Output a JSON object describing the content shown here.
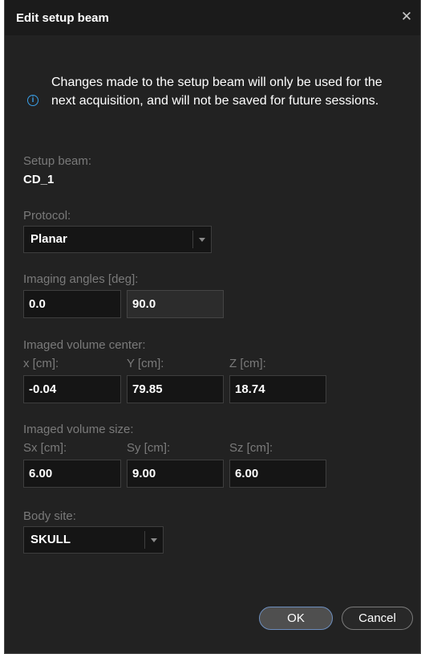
{
  "dialog": {
    "title": "Edit setup beam",
    "close_glyph": "✕",
    "info_icon": "info-icon",
    "info_text": "Changes made to the setup beam will only be used for the next acquisition, and will not be saved for future sessions."
  },
  "setup_beam": {
    "label": "Setup beam:",
    "value": "CD_1"
  },
  "protocol": {
    "label": "Protocol:",
    "value": "Planar"
  },
  "imaging_angles": {
    "label": "Imaging angles [deg]:",
    "angle1": "0.0",
    "angle2": "90.0"
  },
  "volume_center": {
    "label": "Imaged volume center:",
    "x_label": "x [cm]:",
    "y_label": "Y [cm]:",
    "z_label": "Z [cm]:",
    "x": "-0.04",
    "y": "79.85",
    "z": "18.74"
  },
  "volume_size": {
    "label": "Imaged volume size:",
    "sx_label": "Sx [cm]:",
    "sy_label": "Sy [cm]:",
    "sz_label": "Sz [cm]:",
    "sx": "6.00",
    "sy": "9.00",
    "sz": "6.00"
  },
  "body_site": {
    "label": "Body site:",
    "value": "SKULL"
  },
  "buttons": {
    "ok": "OK",
    "cancel": "Cancel"
  },
  "colors": {
    "background": "#222222",
    "titlebar": "#1b1b1b",
    "info_accent": "#3aa0e8",
    "label": "#7a7a7a",
    "ok_border": "#6d8ebe"
  }
}
